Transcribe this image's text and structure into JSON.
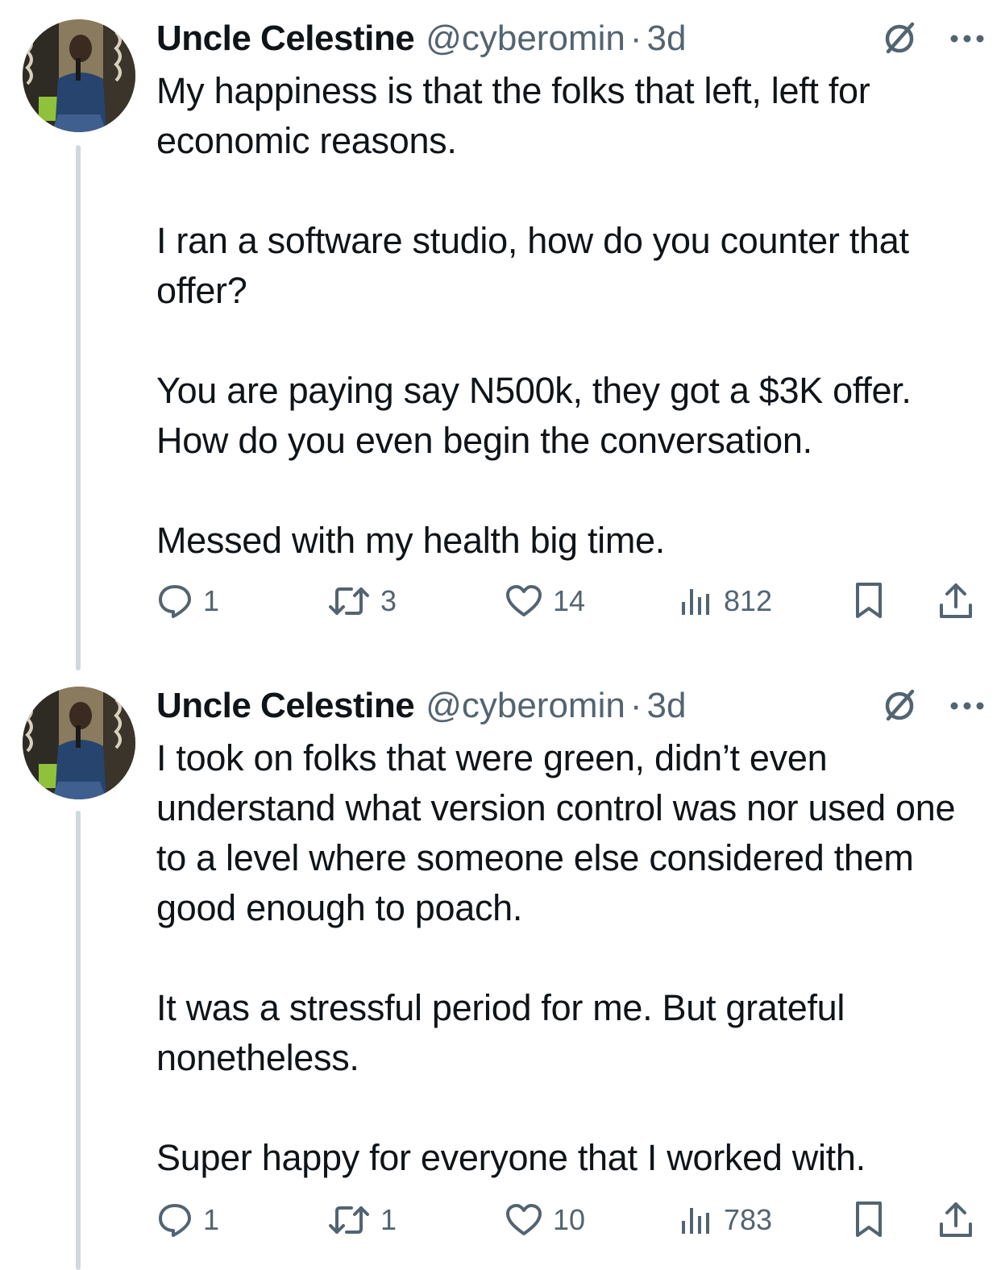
{
  "tweets": [
    {
      "author": {
        "display_name": "Uncle Celestine",
        "handle": "@cyberomin",
        "separator": "·",
        "time": "3d"
      },
      "paragraphs": [
        "My happiness is that the folks that left, left for economic reasons.",
        "I ran a software studio, how do you counter that offer?",
        "You are paying say N500k, they got a $3K offer. How do you even begin the conversation.",
        "Messed with my health big time."
      ],
      "stats": {
        "replies": "1",
        "reposts": "3",
        "likes": "14",
        "views": "812"
      }
    },
    {
      "author": {
        "display_name": "Uncle Celestine",
        "handle": "@cyberomin",
        "separator": "·",
        "time": "3d"
      },
      "paragraphs": [
        "I took on folks that were green, didn’t even understand what version control was nor used one to a level where someone else considered them good enough to poach.",
        "It was a stressful period for me. But grateful nonetheless.",
        "Super happy for everyone that I worked with."
      ],
      "stats": {
        "replies": "1",
        "reposts": "1",
        "likes": "10",
        "views": "783"
      }
    }
  ],
  "icons": {
    "grok": "grok-icon",
    "more": "more-icon",
    "reply": "reply-icon",
    "repost": "repost-icon",
    "like": "heart-icon",
    "views": "views-icon",
    "bookmark": "bookmark-icon",
    "share": "share-icon"
  },
  "colors": {
    "text": "#0f1419",
    "muted": "#536471",
    "thread_line": "#cfd9de",
    "background": "#ffffff"
  }
}
